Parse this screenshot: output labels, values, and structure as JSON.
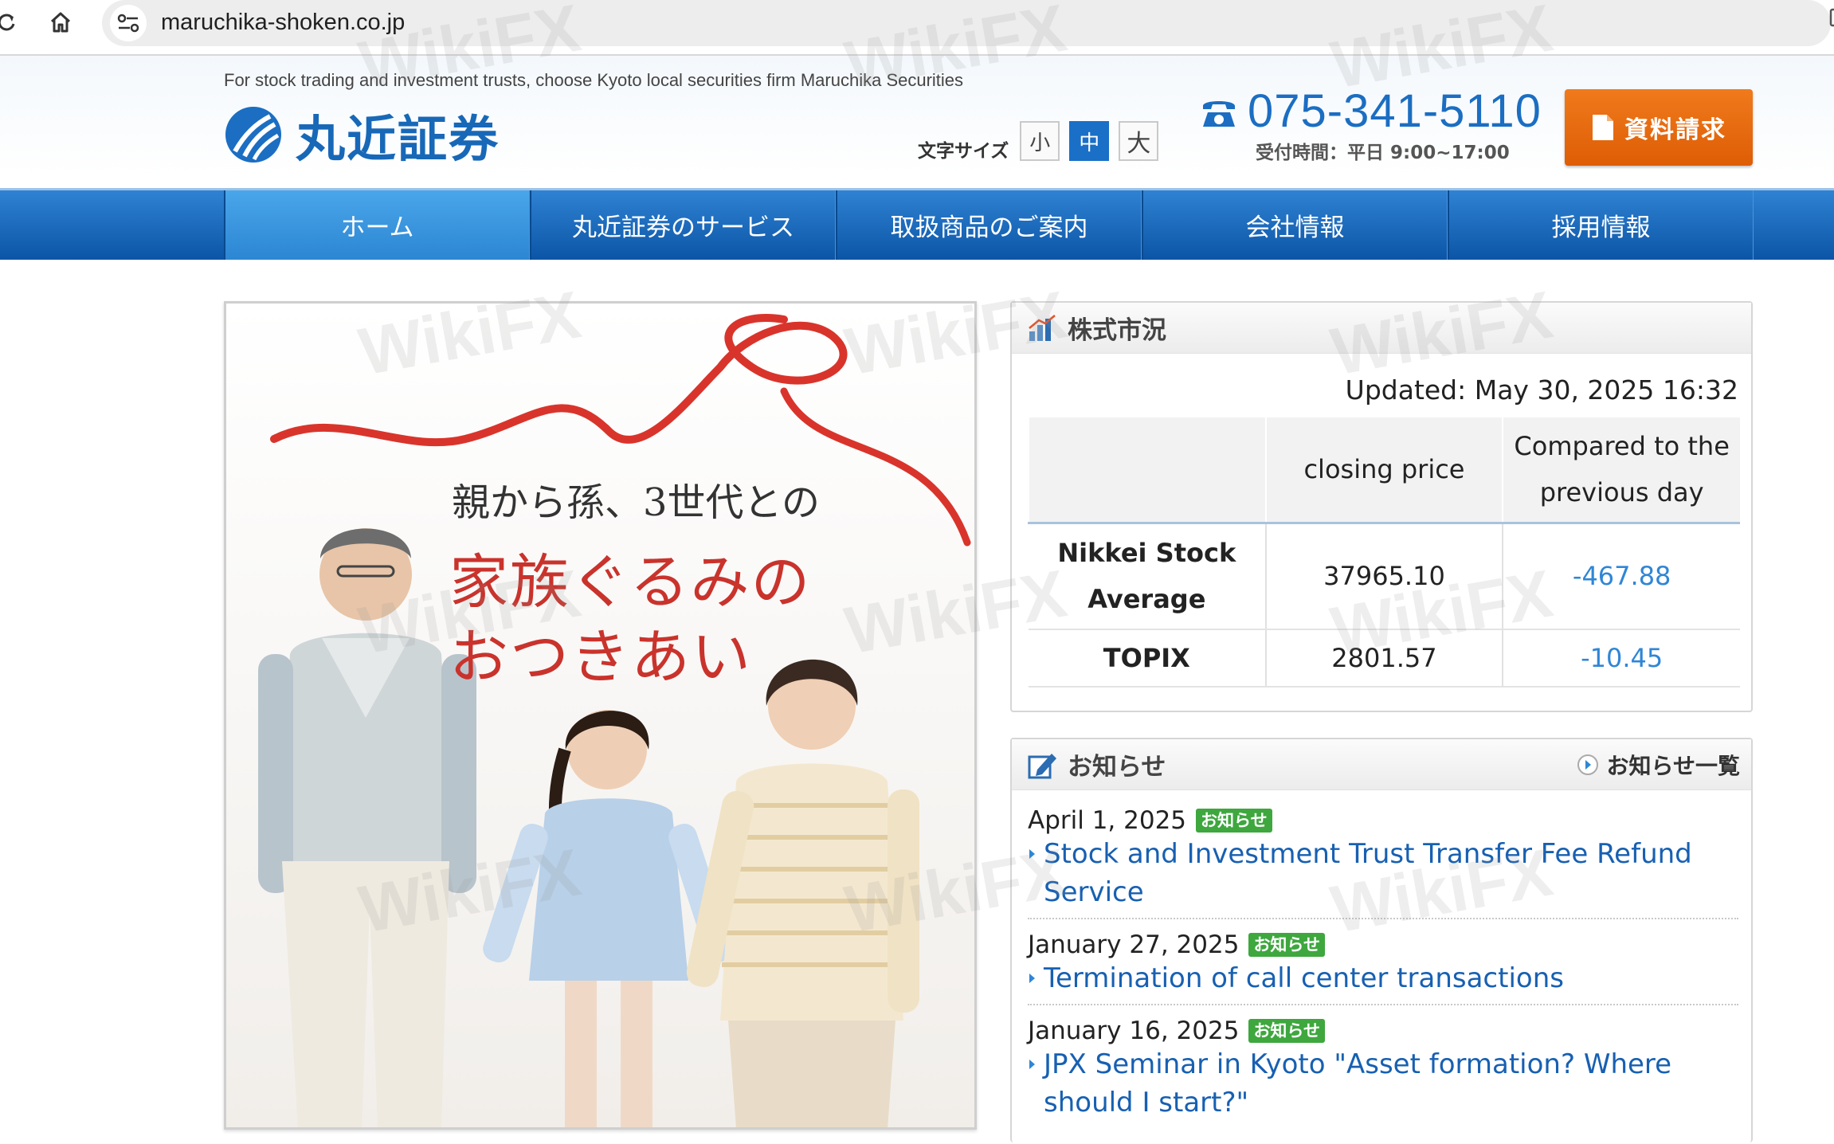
{
  "browser": {
    "url": "maruchika-shoken.co.jp"
  },
  "header": {
    "tagline": "For stock trading and investment trusts, choose Kyoto local securities firm Maruchika Securities",
    "logo_text": "丸近証券",
    "font_size": {
      "label": "文字サイズ",
      "options": [
        "小",
        "中",
        "大"
      ],
      "selected": "中"
    },
    "phone": {
      "number": "075-341-5110",
      "hours": "受付時間：平日 9:00~17:00"
    },
    "request_button": "資料請求"
  },
  "nav": {
    "items": [
      "ホーム",
      "丸近証券のサービス",
      "取扱商品のご案内",
      "会社情報",
      "採用情報"
    ],
    "current": "ホーム"
  },
  "hero": {
    "line1": "親から孫、3世代との",
    "line2": "家族ぐるみの",
    "line3": "おつきあい"
  },
  "market": {
    "title": "株式市況",
    "updated": "Updated: May 30, 2025 16:32",
    "columns": [
      "",
      "closing price",
      "Compared to the previous day"
    ],
    "rows": [
      {
        "name": "Nikkei Stock Average",
        "closing": "37965.10",
        "change": "-467.88"
      },
      {
        "name": "TOPIX",
        "closing": "2801.57",
        "change": "-10.45"
      }
    ]
  },
  "news": {
    "title": "お知らせ",
    "list_link": "お知らせ一覧",
    "items": [
      {
        "date": "April 1, 2025",
        "badge": "お知らせ",
        "title": "Stock and Investment Trust Transfer Fee Refund Service"
      },
      {
        "date": "January 27, 2025",
        "badge": "お知らせ",
        "title": "Termination of call center transactions"
      },
      {
        "date": "January 16, 2025",
        "badge": "お知らせ",
        "title": "JPX Seminar in Kyoto \"Asset formation? Where should I start?\""
      }
    ]
  },
  "watermark": "WikiFX",
  "colors": {
    "brand_blue": "#1b6ec2",
    "nav_blue": "#0c55a6",
    "accent_orange": "#e8690f",
    "hero_red": "#c9332c",
    "change_blue": "#2f86d6",
    "badge_green": "#3ea73e"
  }
}
